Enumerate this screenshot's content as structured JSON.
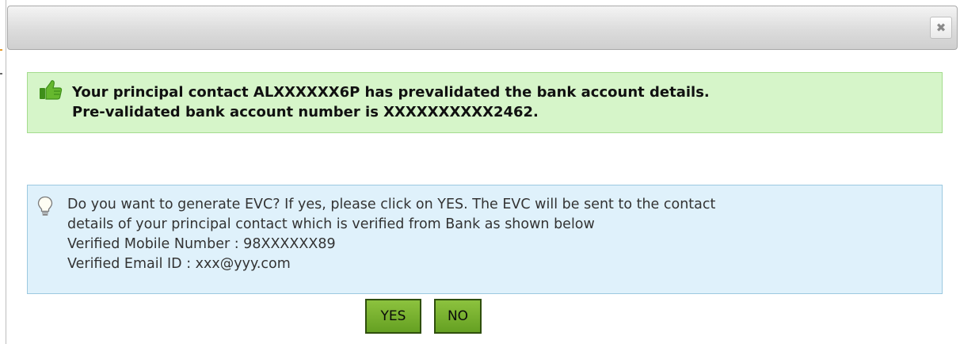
{
  "dialog": {
    "close_glyph": "✖"
  },
  "success_message": {
    "icon": "thumbs-up-icon",
    "lines": [
      "Your principal contact ALXXXXXX6P has prevalidated the bank account details.",
      "Pre-validated bank account number is XXXXXXXXXX2462."
    ]
  },
  "info_message": {
    "icon": "lightbulb-icon",
    "lines": [
      "Do you want to generate EVC? If yes, please click on YES. The EVC will be sent to the contact",
      "details of your principal contact which is verified from Bank as shown below",
      "Verified Mobile Number : 98XXXXXX89",
      "Verified Email ID : xxx@yyy.com"
    ]
  },
  "buttons": {
    "yes_label": "YES",
    "no_label": "NO"
  },
  "colors": {
    "success_bg": "#d6f5c9",
    "success_border": "#a4dc8e",
    "info_bg": "#dff1fb",
    "info_border": "#9cc9e0",
    "button_green": "#79b330",
    "button_border": "#2f4f0d"
  }
}
